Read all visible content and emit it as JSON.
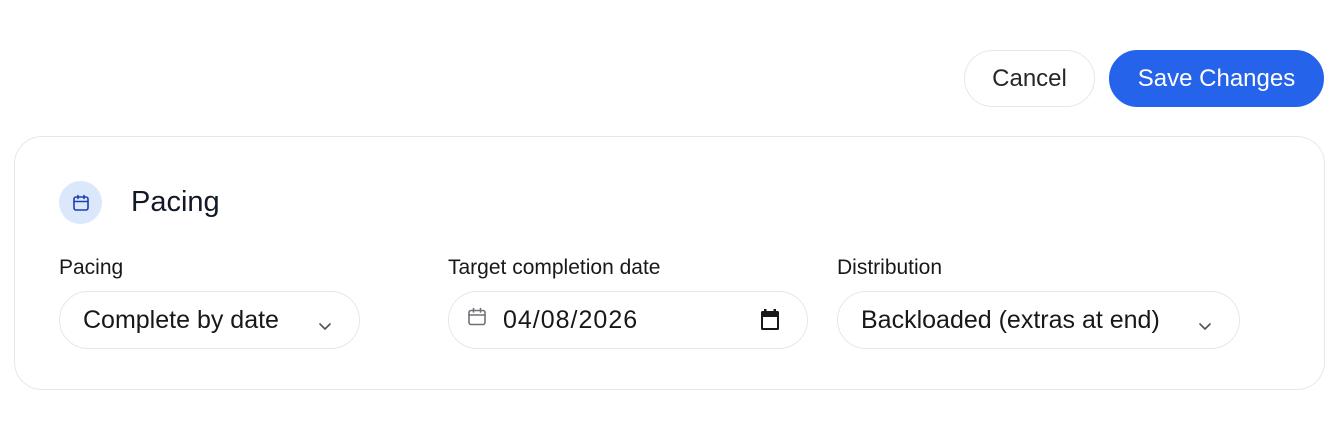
{
  "actions": {
    "cancel_label": "Cancel",
    "save_label": "Save Changes"
  },
  "pacing_card": {
    "title": "Pacing",
    "icon": "calendar-icon",
    "fields": {
      "pacing": {
        "label": "Pacing",
        "value": "Complete by date"
      },
      "target_date": {
        "label": "Target completion date",
        "value": "04/08/2026"
      },
      "distribution": {
        "label": "Distribution",
        "value": "Backloaded (extras at end)"
      }
    }
  },
  "colors": {
    "accent": "#2563eb",
    "icon_bg": "#dbe7fb",
    "border": "#e5e7eb"
  }
}
